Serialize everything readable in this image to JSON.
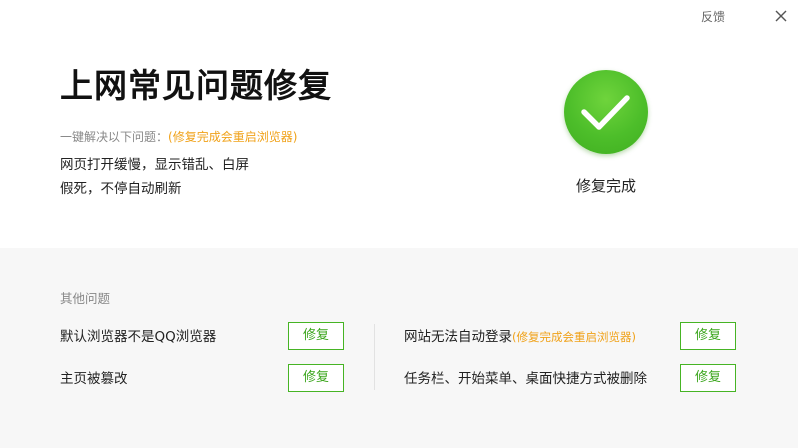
{
  "header": {
    "feedback_label": "反馈",
    "close_icon": "close-icon"
  },
  "main": {
    "title": "上网常见问题修复",
    "subtitle_prefix": "一键解决以下问题：",
    "subtitle_note": "(修复完成会重启浏览器)",
    "issues": [
      "网页打开缓慢，显示错乱、白屏",
      "假死，不停自动刷新"
    ],
    "status_icon": "checkmark-icon",
    "status_label": "修复完成",
    "accent_color": "#4dbe2a"
  },
  "other": {
    "section_title": "其他问题",
    "left_items": [
      {
        "label": "默认浏览器不是QQ浏览器",
        "note": "",
        "button": "修复"
      },
      {
        "label": "主页被篡改",
        "note": "",
        "button": "修复"
      }
    ],
    "right_items": [
      {
        "label": "网站无法自动登录",
        "note": "(修复完成会重启浏览器)",
        "button": "修复"
      },
      {
        "label": "任务栏、开始菜单、桌面快捷方式被删除",
        "note": "",
        "button": "修复"
      }
    ],
    "note_color": "#f0a21a"
  }
}
